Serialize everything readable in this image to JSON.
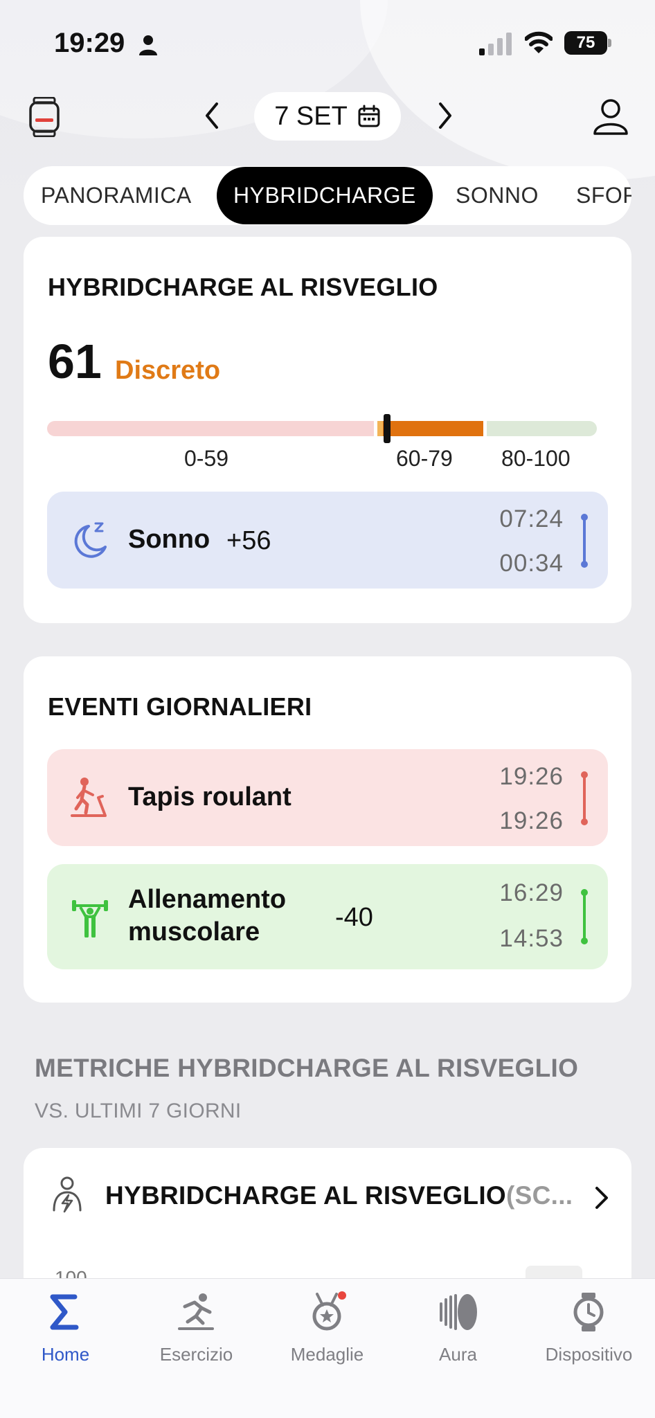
{
  "status_bar": {
    "time": "19:29",
    "battery": "75"
  },
  "header": {
    "date": "7 SET"
  },
  "tabs": [
    "PANORAMICA",
    "HYBRIDCHARGE",
    "SONNO",
    "SFORZO"
  ],
  "wake_card": {
    "title": "HYBRIDCHARGE AL RISVEGLIO",
    "score": "61",
    "score_label": "Discreto",
    "score_value": 61,
    "ranges": [
      "0-59",
      "60-79",
      "80-100"
    ],
    "sleep": {
      "label": "Sonno",
      "value": "+56",
      "end": "07:24",
      "start": "00:34"
    }
  },
  "events_card": {
    "title": "EVENTI GIORNALIERI",
    "events": [
      {
        "label": "Tapis roulant",
        "value": "",
        "end": "19:26",
        "start": "19:26"
      },
      {
        "label_line1": "Allenamento",
        "label_line2": "muscolare",
        "value": "-40",
        "end": "16:29",
        "start": "14:53"
      }
    ]
  },
  "metrics_section": {
    "title": "METRICHE HYBRIDCHARGE AL RISVEGLIO",
    "subtitle": "VS. ULTIMI 7 GIORNI",
    "card_title": "HYBRIDCHARGE AL RISVEGLIO",
    "card_title_suffix": "(SC...",
    "axis_top": "100"
  },
  "colors": {
    "accent_orange": "#e07a16",
    "sleep_blue": "#5b78d6",
    "event_red": "#e0645a",
    "event_green": "#3fc23f",
    "nav_active": "#2f58c8"
  },
  "nav": [
    {
      "label": "Home",
      "icon": "sigma-icon"
    },
    {
      "label": "Esercizio",
      "icon": "running-icon"
    },
    {
      "label": "Medaglie",
      "icon": "medal-icon"
    },
    {
      "label": "Aura",
      "icon": "aura-icon"
    },
    {
      "label": "Dispositivo",
      "icon": "watch-icon"
    }
  ]
}
